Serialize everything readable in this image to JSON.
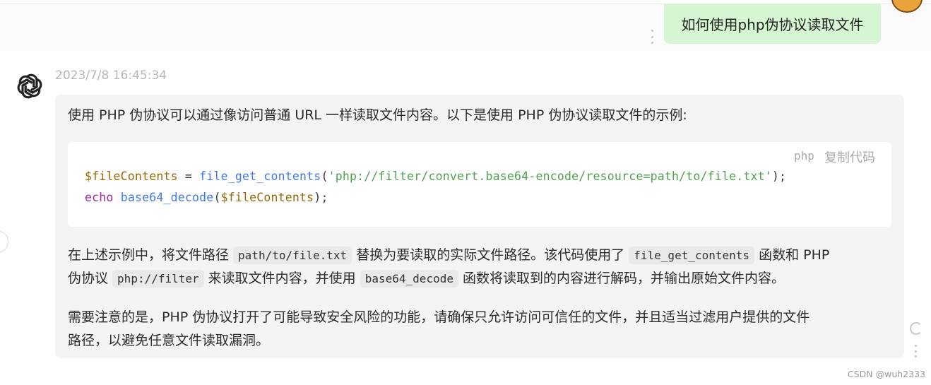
{
  "user_message": {
    "text": "如何使用php伪协议读取文件"
  },
  "bot_message": {
    "timestamp": "2023/7/8 16:45:34",
    "intro": "使用 PHP 伪协议可以通过像访问普通 URL 一样读取文件内容。以下是使用 PHP 伪协议读取文件的示例:",
    "code": {
      "language": "php",
      "copy_label": "复制代码",
      "line1": {
        "var": "$fileContents",
        "op": " = ",
        "fn": "file_get_contents",
        "open": "(",
        "str": "'php://filter/convert.base64-encode/resource=path/to/file.txt'",
        "close": ");"
      },
      "line2": {
        "kw": "echo",
        "sp": " ",
        "fn": "base64_decode",
        "open": "(",
        "var": "$fileContents",
        "close": ");"
      }
    },
    "para2": {
      "t1": "在上述示例中，将文件路径 ",
      "c1": "path/to/file.txt",
      "t2": " 替换为要读取的实际文件路径。该代码使用了 ",
      "c2": "file_get_contents",
      "t3": " 函数和 PHP",
      "t4": "伪协议 ",
      "c3": "php://filter",
      "t5": " 来读取文件内容，并使用 ",
      "c4": "base64_decode",
      "t6": " 函数将读取到的内容进行解码，并输出原始文件内容。"
    },
    "para3": {
      "line1": "需要注意的是，PHP 伪协议打开了可能导致安全风险的功能，请确保只允许访问可信任的文件，并且适当过滤用户提供的文件",
      "line2": "路径，以避免任意文件读取漏洞。"
    }
  },
  "watermark": "CSDN @wuh2333",
  "icons": [
    "openai-logo-icon",
    "kebab-menu-icon",
    "refresh-icon",
    "user-avatar"
  ],
  "colors": {
    "user_bubble": "#d6f5d2",
    "answer_card": "#f3f4f6"
  }
}
